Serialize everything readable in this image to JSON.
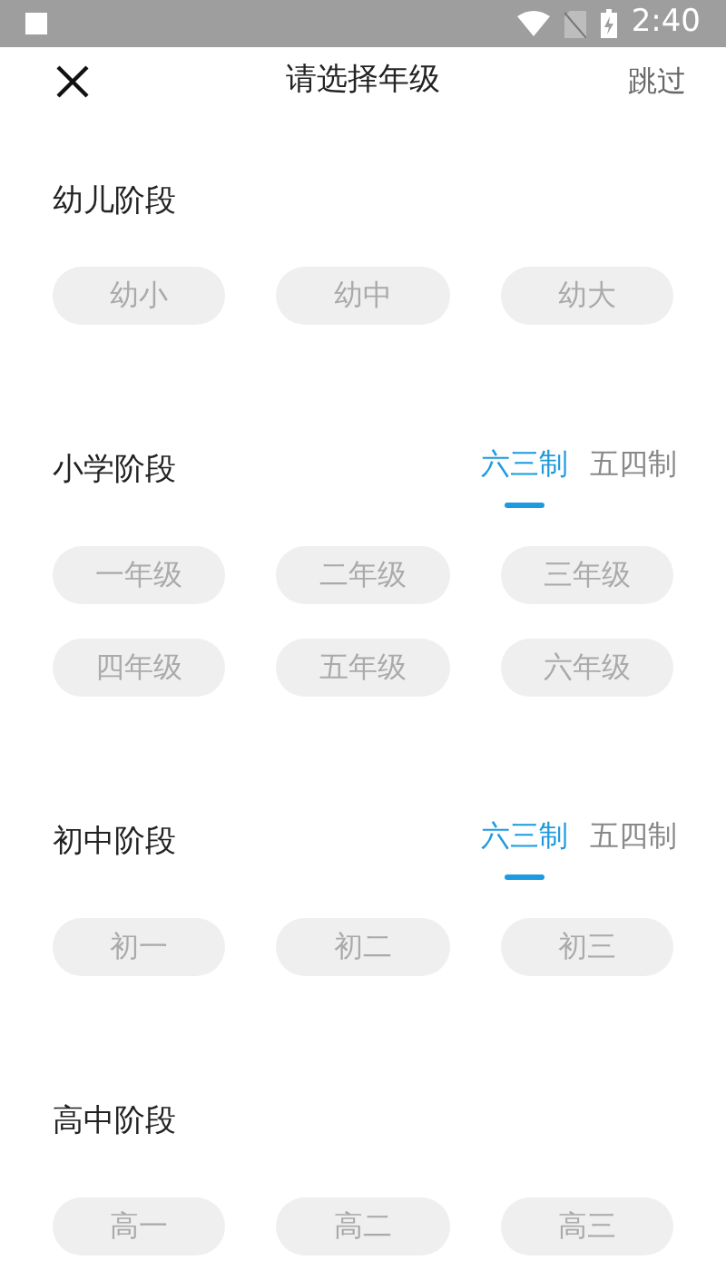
{
  "status_bar": {
    "time": "2:40"
  },
  "header": {
    "title": "请选择年级",
    "skip": "跳过"
  },
  "sections": [
    {
      "title": "幼儿阶段",
      "grades": [
        {
          "label": "幼小",
          "selected": false
        },
        {
          "label": "幼中",
          "selected": false
        },
        {
          "label": "幼大",
          "selected": false
        }
      ]
    },
    {
      "title": "小学阶段",
      "tabs": [
        {
          "label": "六三制",
          "selected": true
        },
        {
          "label": "五四制",
          "selected": false
        }
      ],
      "grades": [
        {
          "label": "一年级",
          "selected": false
        },
        {
          "label": "二年级",
          "selected": false
        },
        {
          "label": "三年级",
          "selected": false
        },
        {
          "label": "四年级",
          "selected": false
        },
        {
          "label": "五年级",
          "selected": false
        },
        {
          "label": "六年级",
          "selected": false
        }
      ]
    },
    {
      "title": "初中阶段",
      "tabs": [
        {
          "label": "六三制",
          "selected": true
        },
        {
          "label": "五四制",
          "selected": false
        }
      ],
      "grades": [
        {
          "label": "初一",
          "selected": false
        },
        {
          "label": "初二",
          "selected": false
        },
        {
          "label": "初三",
          "selected": false
        }
      ]
    },
    {
      "title": "高中阶段",
      "grades": [
        {
          "label": "高一",
          "selected": false
        },
        {
          "label": "高二",
          "selected": false
        },
        {
          "label": "高三",
          "selected": false
        }
      ]
    }
  ]
}
